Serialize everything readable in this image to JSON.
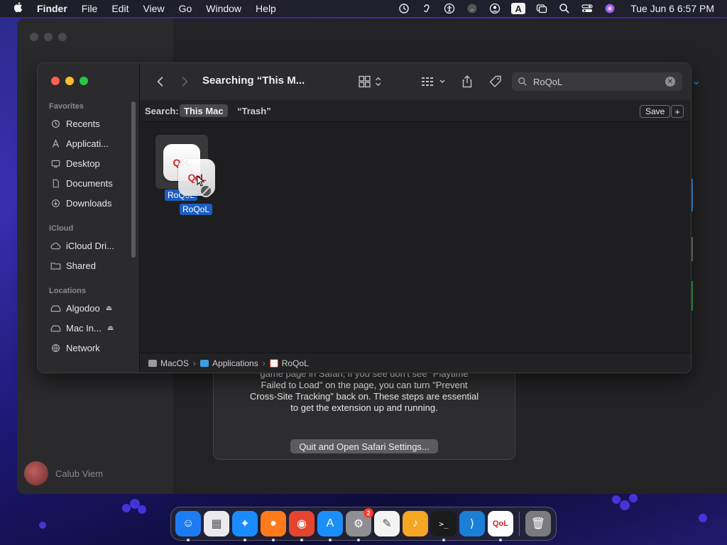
{
  "menubar": {
    "app_name": "Finder",
    "menus": [
      "File",
      "Edit",
      "View",
      "Go",
      "Window",
      "Help"
    ],
    "status_icons": [
      "time-machine-icon",
      "hearing-icon",
      "accessibility-icon",
      "airplay-icon",
      "user-icon",
      "keyboard-input-icon",
      "screen-mirroring-icon",
      "spotlight-icon",
      "control-center-icon",
      "siri-icon"
    ],
    "input_source": "A",
    "clock": "Tue Jun 6  6:57 PM"
  },
  "background_window": {
    "user_name": "Calub Viem"
  },
  "dialog": {
    "body_lines": [
      "game page in Safari, if you see don't see \"Playtime",
      "Failed to Load\" on the page, you can turn \"Prevent",
      "Cross-Site Tracking\" back on. These steps are essential",
      "to get the extension up and running."
    ],
    "button_label": "Quit and Open Safari Settings..."
  },
  "finder": {
    "title": "Searching “This M...",
    "search": {
      "value": "RoQoL",
      "placeholder": "Search"
    },
    "scope": {
      "label": "Search:",
      "options": [
        "This Mac",
        "“Trash”"
      ],
      "active": "This Mac",
      "save_label": "Save",
      "add_label": "+"
    },
    "sidebar": {
      "favorites_header": "Favorites",
      "favorites": [
        {
          "label": "Recents",
          "icon": "clock-icon"
        },
        {
          "label": "Applicati...",
          "icon": "applications-icon"
        },
        {
          "label": "Desktop",
          "icon": "desktop-icon"
        },
        {
          "label": "Documents",
          "icon": "document-icon"
        },
        {
          "label": "Downloads",
          "icon": "download-icon"
        }
      ],
      "icloud_header": "iCloud",
      "icloud": [
        {
          "label": "iCloud Dri...",
          "icon": "cloud-icon"
        },
        {
          "label": "Shared",
          "icon": "shared-folder-icon"
        }
      ],
      "locations_header": "Locations",
      "locations": [
        {
          "label": "Algodoo",
          "icon": "drive-icon",
          "eject": "⏏"
        },
        {
          "label": "Mac In...",
          "icon": "drive-icon",
          "eject": "⏏"
        },
        {
          "label": "Network",
          "icon": "network-icon"
        }
      ]
    },
    "results": [
      {
        "name": "RoQoL",
        "icon_text": "QoL"
      }
    ],
    "drag_preview": {
      "name": "RoQoL",
      "icon_text": "QoL"
    },
    "pathbar": [
      "MacOS",
      "Applications",
      "RoQoL"
    ]
  },
  "dock": {
    "apps": [
      {
        "name": "finder",
        "glyph": "☺",
        "color": "#1e7cf2",
        "running": true
      },
      {
        "name": "launchpad",
        "glyph": "▦",
        "color": "#e9e9ee",
        "running": false
      },
      {
        "name": "safari",
        "glyph": "✦",
        "color": "#1a8cff",
        "running": true
      },
      {
        "name": "firefox",
        "glyph": "●",
        "color": "#ff7a1a",
        "running": true
      },
      {
        "name": "chrome",
        "glyph": "◉",
        "color": "#e5452f",
        "running": true
      },
      {
        "name": "app-store",
        "glyph": "A",
        "color": "#1c8ef9",
        "running": true
      },
      {
        "name": "system-settings",
        "glyph": "⚙",
        "color": "#8e8e93",
        "running": true,
        "badge": "2"
      },
      {
        "name": "textedit",
        "glyph": "✎",
        "color": "#f3f3f3",
        "running": false
      },
      {
        "name": "garageband",
        "glyph": "♪",
        "color": "#f5a623",
        "running": false
      },
      {
        "name": "terminal",
        "glyph": ">_",
        "color": "#1b1b1b",
        "running": true
      },
      {
        "name": "vscode",
        "glyph": "⟩",
        "color": "#1b7fd6",
        "running": false
      },
      {
        "name": "roqol",
        "glyph": "QoL",
        "color": "#ffffff",
        "running": true
      },
      {
        "name": "trash",
        "glyph": "🗑",
        "color": "#7c7c80",
        "running": false
      }
    ]
  }
}
